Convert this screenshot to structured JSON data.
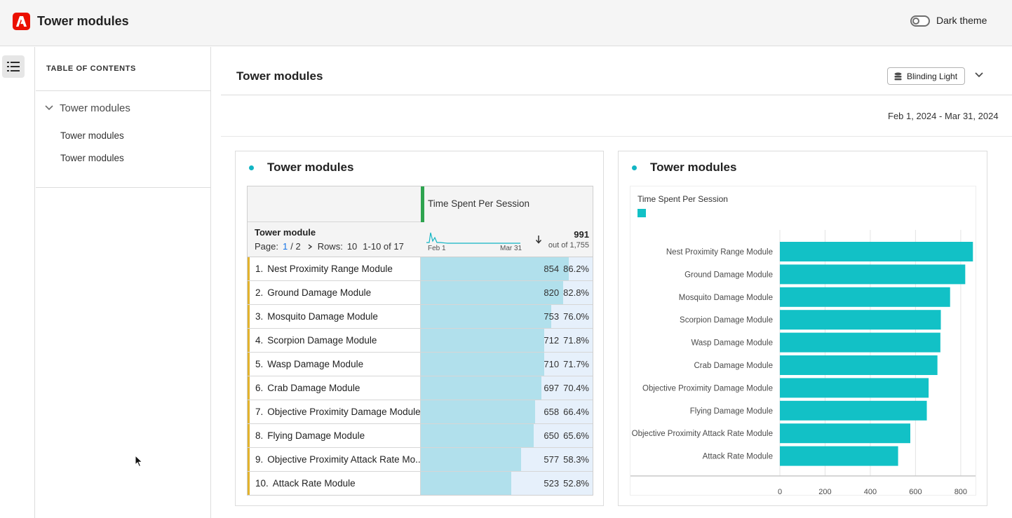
{
  "app": {
    "title": "Tower modules",
    "theme_label": "Dark theme"
  },
  "toc": {
    "header": "TABLE OF CONTENTS",
    "group_label": "Tower modules",
    "items": [
      "Tower modules",
      "Tower modules"
    ]
  },
  "main": {
    "title": "Tower modules",
    "data_source_label": "Blinding Light",
    "date_range": "Feb 1, 2024 - Mar 31, 2024"
  },
  "table_card": {
    "title": "Tower modules",
    "metric_label": "Time Spent Per Session",
    "dimension_label": "Tower module",
    "pager": {
      "page_label": "Page:",
      "current_page": "1",
      "total_pages": "/ 2",
      "rows_label": "Rows:",
      "rows_value": "10",
      "range": "1-10 of 17"
    },
    "spark_start": "Feb 1",
    "spark_end": "Mar 31",
    "total_value": "991",
    "total_sub": "out of 1,755",
    "rows": [
      {
        "num": "1.",
        "name": "Nest Proximity Range Module",
        "value": "854",
        "pct": "86.2%",
        "frac": 0.862
      },
      {
        "num": "2.",
        "name": "Ground Damage Module",
        "value": "820",
        "pct": "82.8%",
        "frac": 0.828
      },
      {
        "num": "3.",
        "name": "Mosquito Damage Module",
        "value": "753",
        "pct": "76.0%",
        "frac": 0.76
      },
      {
        "num": "4.",
        "name": "Scorpion Damage Module",
        "value": "712",
        "pct": "71.8%",
        "frac": 0.718
      },
      {
        "num": "5.",
        "name": "Wasp Damage Module",
        "value": "710",
        "pct": "71.7%",
        "frac": 0.717
      },
      {
        "num": "6.",
        "name": "Crab Damage Module",
        "value": "697",
        "pct": "70.4%",
        "frac": 0.704
      },
      {
        "num": "7.",
        "name": "Objective Proximity Damage Module",
        "value": "658",
        "pct": "66.4%",
        "frac": 0.664
      },
      {
        "num": "8.",
        "name": "Flying Damage Module",
        "value": "650",
        "pct": "65.6%",
        "frac": 0.656
      },
      {
        "num": "9.",
        "name": "Objective Proximity Attack Rate Mo...",
        "value": "577",
        "pct": "58.3%",
        "frac": 0.583
      },
      {
        "num": "10.",
        "name": "Attack Rate Module",
        "value": "523",
        "pct": "52.8%",
        "frac": 0.528
      }
    ]
  },
  "chart_card": {
    "title": "Tower modules"
  },
  "colors": {
    "accent": "#12b5c4",
    "bar": "#12c1c6",
    "metric_border": "#2ea44f",
    "row_marker": "#e3b32c",
    "cell_bar": "#b1e0ec",
    "cell_bg": "#e6f0fb",
    "brand": "#eb1000"
  },
  "icons": {
    "logo": "adobe-logo-icon",
    "rail": "list-icon",
    "datasource": "database-icon",
    "sort": "arrow-down-icon"
  },
  "chart_data": {
    "type": "bar",
    "orientation": "horizontal",
    "title": "",
    "categories": [
      "Nest Proximity Range Module",
      "Ground Damage Module",
      "Mosquito Damage Module",
      "Scorpion Damage Module",
      "Wasp Damage Module",
      "Crab Damage Module",
      "Objective Proximity Damage Module",
      "Flying Damage Module",
      "Objective Proximity Attack Rate Module",
      "Attack Rate Module"
    ],
    "series": [
      {
        "name": "Time Spent Per Session",
        "values": [
          854,
          820,
          753,
          712,
          710,
          697,
          658,
          650,
          577,
          523
        ]
      }
    ],
    "xlim": [
      0,
      850
    ],
    "xticks": [
      0,
      200,
      400,
      600,
      800
    ],
    "grid": true,
    "legend": "top-left"
  }
}
